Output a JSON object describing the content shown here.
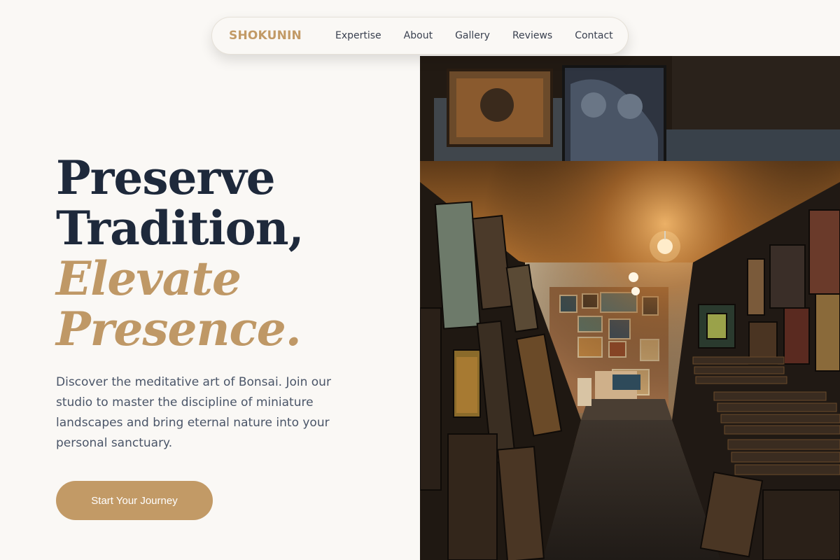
{
  "nav": {
    "brand": "SHOKUNIN",
    "links": [
      "Expertise",
      "About",
      "Gallery",
      "Reviews",
      "Contact"
    ]
  },
  "hero": {
    "title_lines": [
      "Preserve",
      "Tradition,"
    ],
    "accent_lines": [
      "Elevate",
      "Presence."
    ],
    "description": "Discover the meditative art of Bonsai. Join our studio to master the discipline of miniature landscapes and bring eternal nature into your personal sanctuary.",
    "cta_label": "Start Your Journey"
  },
  "colors": {
    "accent": "#c29a66",
    "heading": "#1e293b",
    "background": "#faf8f5",
    "body_text": "#4a5568"
  },
  "image": {
    "subject": "art-gallery-corridor-photo"
  }
}
